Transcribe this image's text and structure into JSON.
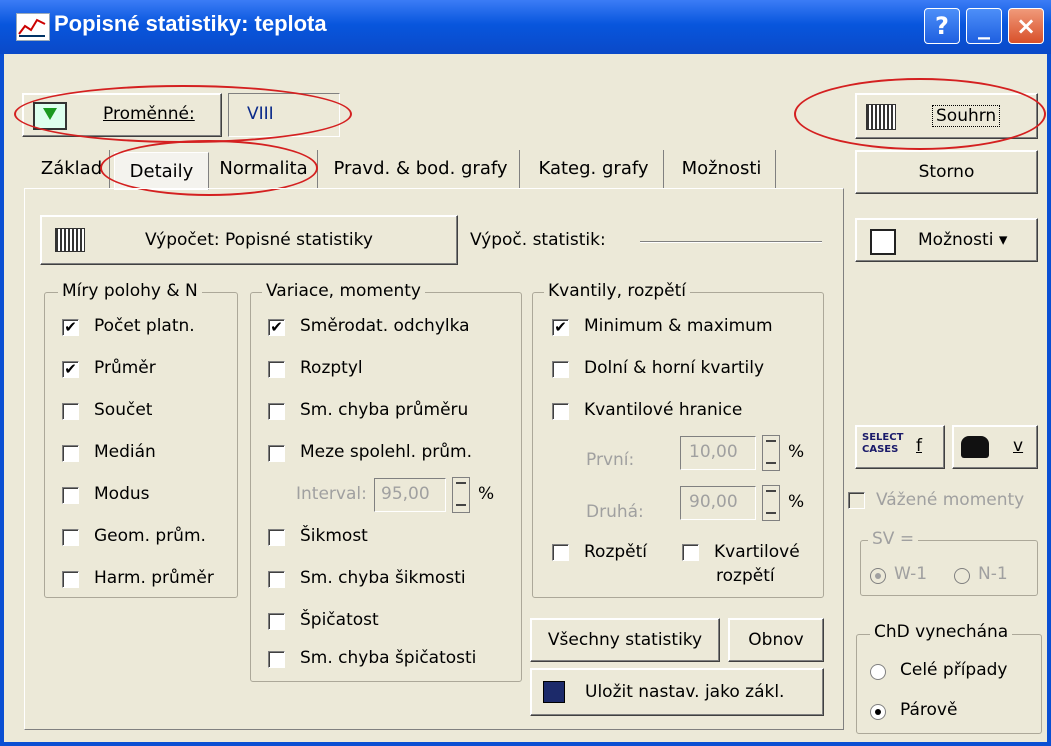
{
  "window": {
    "title": "Popisné statistiky: teplota",
    "help": "?",
    "minimize": "_",
    "close": "×"
  },
  "variables": {
    "button_label": "Proměnné:",
    "value": "VIII"
  },
  "summary_button": "Souhrn",
  "cancel_button": "Storno",
  "options_button": "Možnosti ▾",
  "tabs": [
    {
      "label": "Základ"
    },
    {
      "label": "Detaily"
    },
    {
      "label": "Normalita"
    },
    {
      "label": "Pravd. & bod. grafy"
    },
    {
      "label": "Kateg. grafy"
    },
    {
      "label": "Možnosti"
    }
  ],
  "active_tab": "Detaily",
  "compute_button": "Výpočet: Popisné statistiky",
  "compute_stats_label": "Výpoč. statistik:",
  "location": {
    "title": "Míry polohy & N",
    "items": [
      {
        "label": "Počet platn.",
        "checked": true
      },
      {
        "label": "Průměr",
        "checked": true
      },
      {
        "label": "Součet",
        "checked": false
      },
      {
        "label": "Medián",
        "checked": false
      },
      {
        "label": "Modus",
        "checked": false
      },
      {
        "label": "Geom. prům.",
        "checked": false
      },
      {
        "label": "Harm. průměr",
        "checked": false
      }
    ]
  },
  "variation": {
    "title": "Variace, momenty",
    "items": [
      {
        "label": "Směrodat. odchylka",
        "checked": true
      },
      {
        "label": "Rozptyl",
        "checked": false
      },
      {
        "label": "Sm. chyba průměru",
        "checked": false
      },
      {
        "label": "Meze spolehl. prům.",
        "checked": false
      },
      {
        "label": "Šikmost",
        "checked": false
      },
      {
        "label": "Sm. chyba šikmosti",
        "checked": false
      },
      {
        "label": "Špičatost",
        "checked": false
      },
      {
        "label": "Sm. chyba špičatosti",
        "checked": false
      }
    ],
    "interval_label": "Interval:",
    "interval_value": "95,00",
    "percent": "%"
  },
  "quantiles": {
    "title": "Kvantily, rozpětí",
    "items": [
      {
        "label": "Minimum & maximum",
        "checked": true
      },
      {
        "label": "Dolní & horní kvartily",
        "checked": false
      },
      {
        "label": "Kvantilové hranice",
        "checked": false
      }
    ],
    "first_label": "První:",
    "first_value": "10,00",
    "second_label": "Druhá:",
    "second_value": "90,00",
    "percent": "%",
    "range_label": "Rozpětí",
    "range_checked": false,
    "quartile_range_label_1": "Kvartilové",
    "quartile_range_label_2": "rozpětí",
    "quartile_range_checked": false
  },
  "all_stats_button": "Všechny statistiky",
  "reset_button": "Obnov",
  "save_default_button": "Uložit nastav. jako zákl.",
  "select_cases": {
    "line1": "SELECT",
    "line2": "CASES",
    "f": "f"
  },
  "weight": {
    "v": "v"
  },
  "weighted_moments": {
    "label": "Vážené momenty",
    "checked": false
  },
  "sv": {
    "label": "SV =",
    "w1": "W-1",
    "n1": "N-1"
  },
  "missing": {
    "title": "ChD vynechána",
    "casewise": "Celé případy",
    "pairwise": "Párově",
    "selected": "pairwise"
  }
}
